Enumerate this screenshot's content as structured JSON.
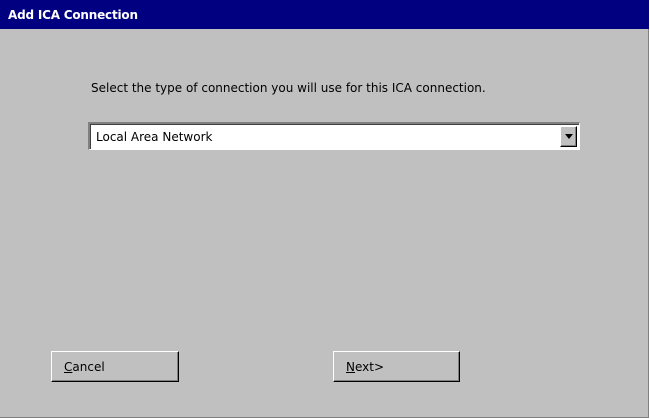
{
  "window": {
    "title": "Add ICA Connection"
  },
  "prompt": {
    "text": "Select the type of connection you will use for this ICA connection."
  },
  "connection_type": {
    "selected": "Local Area Network",
    "arrow_icon": "chevron-down-icon"
  },
  "buttons": {
    "cancel": {
      "mnemonic": "C",
      "rest": "ancel"
    },
    "next": {
      "mnemonic": "N",
      "rest": "ext>"
    }
  },
  "colors": {
    "titlebar": "#000080",
    "title_text": "#ffffff",
    "dialog_background": "#c0c0c0",
    "field_background": "#ffffff"
  }
}
